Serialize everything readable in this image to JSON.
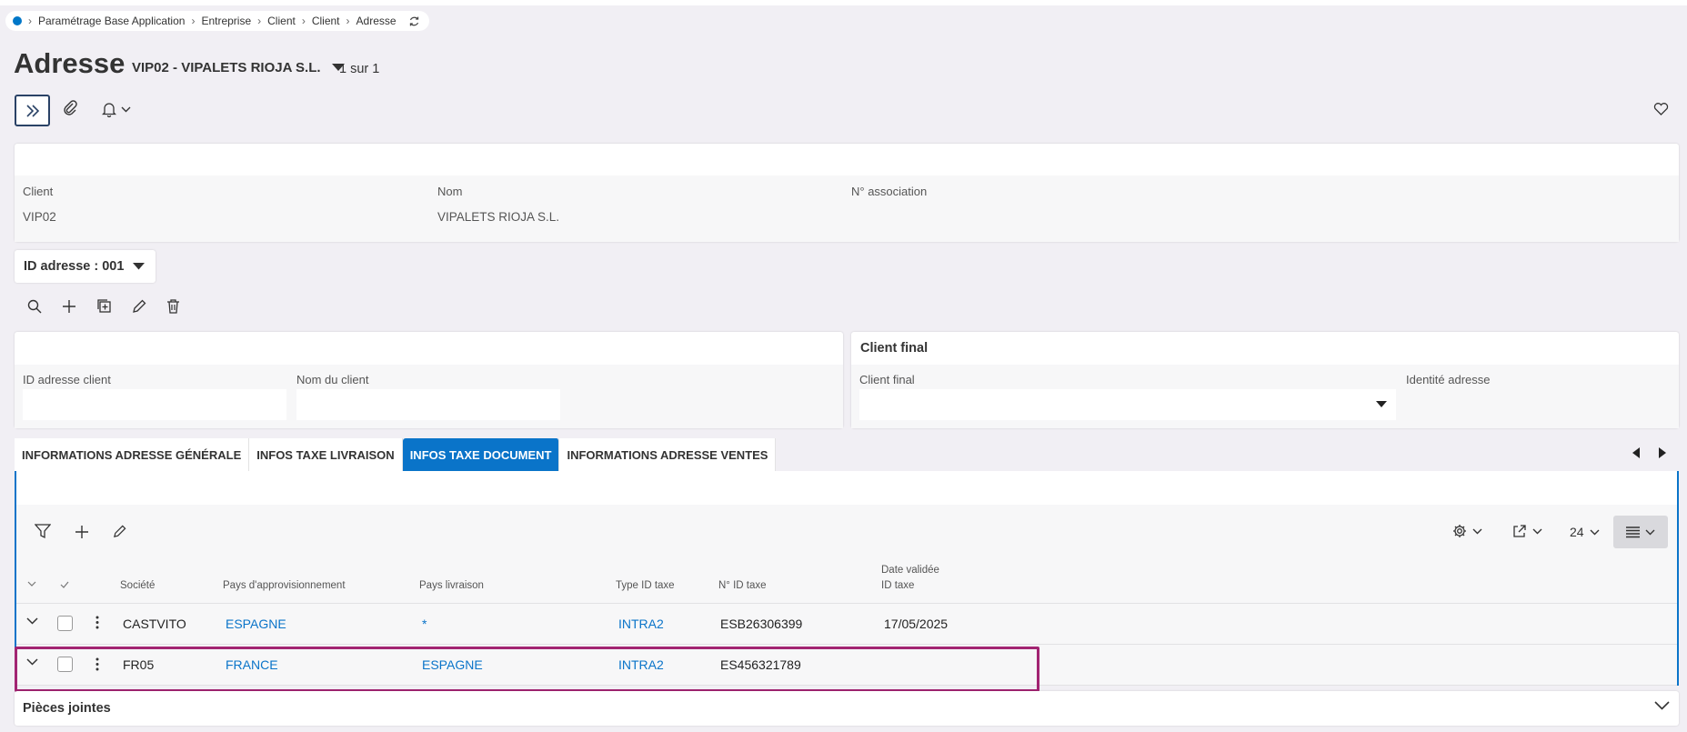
{
  "breadcrumb": {
    "items": [
      "Paramétrage Base Application",
      "Entreprise",
      "Client",
      "Client",
      "Adresse"
    ]
  },
  "page": {
    "title": "Adresse",
    "record_label": "VIP02 - VIPALETS RIOJA S.L.",
    "record_count": "1 sur 1"
  },
  "header": {
    "client_label": "Client",
    "client_value": "VIP02",
    "nom_label": "Nom",
    "nom_value": "VIPALETS RIOJA S.L.",
    "association_label": "N° association",
    "association_value": ""
  },
  "address_selector": {
    "label": "ID adresse : 001"
  },
  "address_card": {
    "id_label": "ID adresse client",
    "id_value": "",
    "name_label": "Nom du client",
    "name_value": ""
  },
  "final_client_card": {
    "title": "Client final",
    "field_label": "Client final",
    "field_value": "",
    "identity_label": "Identité adresse",
    "identity_value": ""
  },
  "tabs": [
    {
      "label": "INFORMATIONS ADRESSE GÉNÉRALE",
      "active": false
    },
    {
      "label": "INFOS TAXE LIVRAISON",
      "active": false
    },
    {
      "label": "INFOS TAXE DOCUMENT",
      "active": true
    },
    {
      "label": "INFORMATIONS ADRESSE VENTES",
      "active": false
    }
  ],
  "grid": {
    "page_size": "24",
    "columns": {
      "societe": "Société",
      "pays_appro": "Pays d'approvisionnement",
      "pays_livraison": "Pays livraison",
      "type_id_taxe": "Type ID taxe",
      "num_id_taxe": "N° ID taxe",
      "date_validee_1": "Date validée",
      "date_validee_2": "ID taxe"
    },
    "rows": [
      {
        "societe": "CASTVITO",
        "pays_appro": "ESPAGNE",
        "pays_livraison": "*",
        "type_id_taxe": "INTRA2",
        "num_id_taxe": "ESB26306399",
        "date_validee": "17/05/2025"
      },
      {
        "societe": "FR05",
        "pays_appro": "FRANCE",
        "pays_livraison": "ESPAGNE",
        "type_id_taxe": "INTRA2",
        "num_id_taxe": "ES456321789",
        "date_validee": ""
      }
    ]
  },
  "attachments": {
    "title": "Pièces jointes"
  },
  "colors": {
    "accent": "#0a74c9",
    "highlight": "#a22472"
  }
}
